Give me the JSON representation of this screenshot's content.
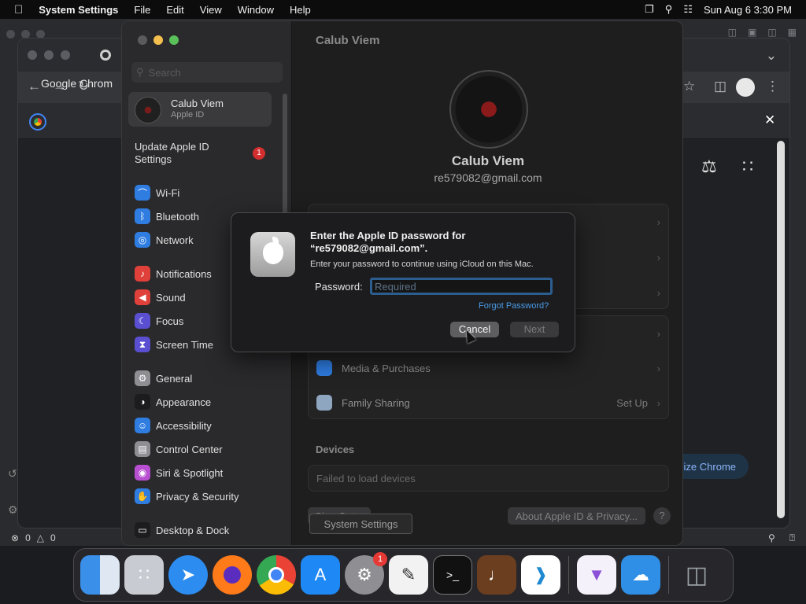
{
  "menubar": {
    "app": "System Settings",
    "items": [
      "File",
      "Edit",
      "View",
      "Window",
      "Help"
    ],
    "datetime": "Sun Aug 6  3:30 PM"
  },
  "statusbar": {
    "errors": "0",
    "warnings": "0"
  },
  "chrome": {
    "title": "Google Chrom",
    "customize": "mize Chrome"
  },
  "settings": {
    "search_placeholder": "Search",
    "account": {
      "name": "Calub Viem",
      "sub": "Apple ID"
    },
    "update": {
      "label": "Update Apple ID Settings",
      "badge": "1"
    },
    "sidebar_items": [
      {
        "label": "Wi-Fi",
        "color": "#2f7de1",
        "icon": "wifi-icon"
      },
      {
        "label": "Bluetooth",
        "color": "#2f7de1",
        "icon": "bluetooth-icon"
      },
      {
        "label": "Network",
        "color": "#2f7de1",
        "icon": "globe-icon"
      },
      {
        "label": "Notifications",
        "color": "#e0403a",
        "icon": "bell-icon"
      },
      {
        "label": "Sound",
        "color": "#e0403a",
        "icon": "speaker-icon"
      },
      {
        "label": "Focus",
        "color": "#5a4fd1",
        "icon": "moon-icon"
      },
      {
        "label": "Screen Time",
        "color": "#5a4fd1",
        "icon": "hourglass-icon"
      },
      {
        "label": "General",
        "color": "#8e8e93",
        "icon": "gear-icon"
      },
      {
        "label": "Appearance",
        "color": "#1c1c1e",
        "icon": "appearance-icon"
      },
      {
        "label": "Accessibility",
        "color": "#2f7de1",
        "icon": "accessibility-icon"
      },
      {
        "label": "Control Center",
        "color": "#8e8e93",
        "icon": "control-center-icon"
      },
      {
        "label": "Siri & Spotlight",
        "color": "#b84fd1",
        "icon": "siri-icon"
      },
      {
        "label": "Privacy & Security",
        "color": "#2f7de1",
        "icon": "hand-icon"
      },
      {
        "label": "Desktop & Dock",
        "color": "#1c1c1e",
        "icon": "dock-icon"
      }
    ],
    "main": {
      "title": "Calub Viem",
      "name": "Calub Viem",
      "email": "re579082@gmail.com",
      "rows": [
        {
          "label": "Media & Purchases",
          "value": ""
        },
        {
          "label": "Family Sharing",
          "value": "Set Up"
        }
      ],
      "devices_heading": "Devices",
      "devices_text": "Failed to load devices",
      "sign_out": "Sign Out...",
      "about": "About Apple ID & Privacy...",
      "help": "?",
      "tooltip": "System Settings"
    }
  },
  "dialog": {
    "title": "Enter the Apple ID password for “re579082@gmail.com”.",
    "subtitle": "Enter your password to continue using iCloud on this Mac.",
    "password_label": "Password:",
    "password_placeholder": "Required",
    "forgot": "Forgot Password?",
    "cancel": "Cancel",
    "next": "Next"
  },
  "dock": {
    "settings_badge": "1",
    "apps": [
      "finder",
      "launchpad",
      "safari",
      "firefox",
      "chrome",
      "app-store",
      "system-settings",
      "textedit",
      "terminal",
      "garageband",
      "vscode",
      "visual-studio",
      "weather",
      "trash"
    ]
  }
}
